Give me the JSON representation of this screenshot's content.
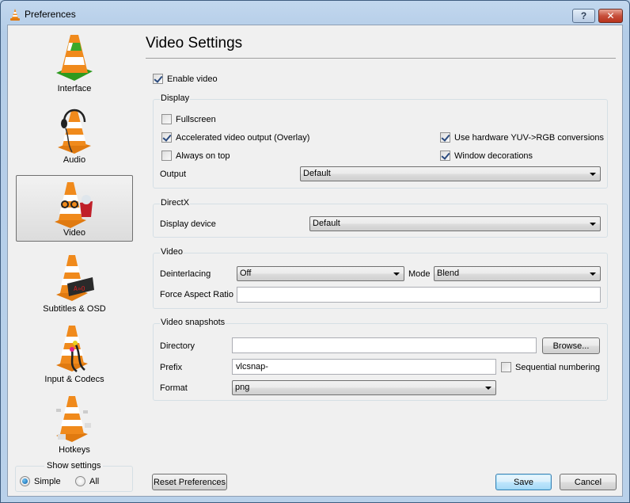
{
  "window": {
    "title": "Preferences",
    "help_button": "?",
    "close_button": "✕"
  },
  "sidebar": {
    "categories": [
      {
        "label": "Interface",
        "icon": "vlc-cone-interface-icon",
        "selected": false
      },
      {
        "label": "Audio",
        "icon": "vlc-cone-audio-icon",
        "selected": false
      },
      {
        "label": "Video",
        "icon": "vlc-cone-video-icon",
        "selected": true
      },
      {
        "label": "Subtitles & OSD",
        "icon": "vlc-cone-subtitles-icon",
        "selected": false
      },
      {
        "label": "Input & Codecs",
        "icon": "vlc-cone-input-icon",
        "selected": false
      },
      {
        "label": "Hotkeys",
        "icon": "vlc-cone-hotkeys-icon",
        "selected": false
      }
    ],
    "show_settings": {
      "title": "Show settings",
      "options": [
        {
          "label": "Simple",
          "selected": true
        },
        {
          "label": "All",
          "selected": false
        }
      ]
    }
  },
  "main": {
    "title": "Video Settings",
    "enable_video": {
      "label": "Enable video",
      "checked": true
    },
    "display": {
      "title": "Display",
      "fullscreen": {
        "label": "Fullscreen",
        "checked": false
      },
      "accelerated": {
        "label": "Accelerated video output (Overlay)",
        "checked": true
      },
      "always_on_top": {
        "label": "Always on top",
        "checked": false
      },
      "hw_yuv": {
        "label": "Use hardware YUV->RGB conversions",
        "checked": true
      },
      "window_decorations": {
        "label": "Window decorations",
        "checked": true
      },
      "output_label": "Output",
      "output_value": "Default"
    },
    "directx": {
      "title": "DirectX",
      "display_device_label": "Display device",
      "display_device_value": "Default"
    },
    "video": {
      "title": "Video",
      "deinterlacing_label": "Deinterlacing",
      "deinterlacing_value": "Off",
      "mode_label": "Mode",
      "mode_value": "Blend",
      "aspect_label": "Force Aspect Ratio",
      "aspect_value": ""
    },
    "snapshots": {
      "title": "Video snapshots",
      "directory_label": "Directory",
      "directory_value": "",
      "browse_label": "Browse...",
      "prefix_label": "Prefix",
      "prefix_value": "vlcsnap-",
      "sequential": {
        "label": "Sequential numbering",
        "checked": false
      },
      "format_label": "Format",
      "format_value": "png"
    }
  },
  "footer": {
    "reset_label": "Reset Preferences",
    "save_label": "Save",
    "cancel_label": "Cancel"
  }
}
